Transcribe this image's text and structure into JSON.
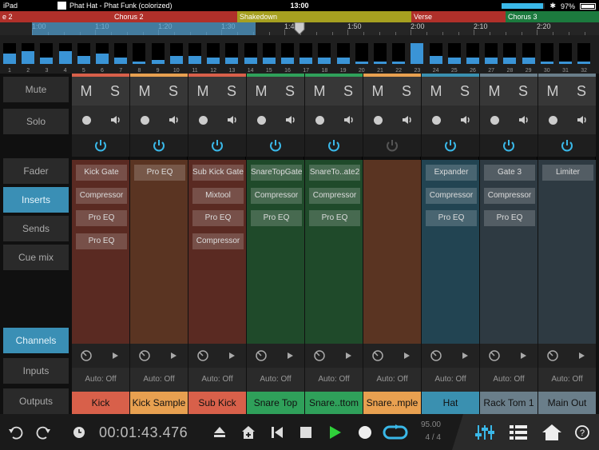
{
  "status": {
    "device": "iPad",
    "document": "Phat Hat - Phat Funk (colorized)",
    "time": "13:00",
    "battery": "97%",
    "level": 0.95,
    "battery_level": 0.97
  },
  "arranger": {
    "sections": [
      {
        "label": "e 2",
        "color": "#b0302a"
      },
      {
        "label": "Chorus 2",
        "color": "#b0302a"
      },
      {
        "label": "Shakedown",
        "color": "#a6a020"
      },
      {
        "label": "Verse",
        "color": "#b0302a"
      },
      {
        "label": "Chorus 3",
        "color": "#1c7a3e"
      }
    ],
    "ticks": [
      "1:00",
      "1:10",
      "1:20",
      "1:30",
      "1:40",
      "1:50",
      "2:00",
      "2:10",
      "2:20"
    ]
  },
  "overview": {
    "numbers": [
      "1",
      "2",
      "3",
      "4",
      "5",
      "6",
      "7",
      "8",
      "9",
      "10",
      "11",
      "12",
      "13",
      "14",
      "15",
      "16",
      "17",
      "18",
      "19",
      "20",
      "21",
      "22",
      "23",
      "24",
      "25",
      "26",
      "27",
      "28",
      "29",
      "30",
      "31",
      "32"
    ],
    "levels": [
      0.5,
      0.6,
      0.3,
      0.6,
      0.4,
      0.5,
      0.3,
      0.1,
      0.2,
      0.4,
      0.4,
      0.3,
      0.3,
      0.3,
      0.3,
      0.3,
      0.3,
      0.3,
      0.3,
      0.1,
      0.1,
      0.1,
      1.0,
      0.4,
      0.3,
      0.3,
      0.3,
      0.3,
      0.3,
      0.1,
      0.1,
      0.1
    ]
  },
  "left_panel": {
    "mute": "Mute",
    "solo": "Solo",
    "fader": "Fader",
    "inserts": "Inserts",
    "sends": "Sends",
    "cue_mix": "Cue mix",
    "channels": "Channels",
    "inputs": "Inputs",
    "outputs": "Outputs"
  },
  "channels": [
    {
      "name": "Kick",
      "color": "#d8604a",
      "bg": "#5a2a22",
      "m": "M",
      "s": "S",
      "auto": "Auto: Off",
      "inserts": [
        "Kick Gate",
        "Compressor",
        "Pro EQ",
        "Pro EQ"
      ],
      "power": "on"
    },
    {
      "name": "Kick Sample",
      "color": "#e8a050",
      "bg": "#5a3422",
      "m": "M",
      "s": "S",
      "auto": "Auto: Off",
      "inserts": [
        "Pro EQ"
      ],
      "power": "on"
    },
    {
      "name": "Sub Kick",
      "color": "#d8604a",
      "bg": "#5a2a22",
      "m": "M",
      "s": "S",
      "auto": "Auto: Off",
      "inserts": [
        "Sub Kick Gate",
        "Mixtool",
        "Pro EQ",
        "Compressor"
      ],
      "power": "on"
    },
    {
      "name": "Snare Top",
      "color": "#2fa05a",
      "bg": "#1f4a2a",
      "m": "M",
      "s": "S",
      "auto": "Auto: Off",
      "inserts": [
        "SnareTopGate",
        "Compressor",
        "Pro EQ"
      ],
      "power": "on"
    },
    {
      "name": "Snare..ttom",
      "color": "#2fa05a",
      "bg": "#1f4a2a",
      "m": "M",
      "s": "S",
      "auto": "Auto: Off",
      "inserts": [
        "SnareTo..ate2",
        "Compressor",
        "Pro EQ"
      ],
      "power": "on"
    },
    {
      "name": "Snare..mple",
      "color": "#e8a050",
      "bg": "#5a3422",
      "m": "M",
      "s": "S",
      "auto": "Auto: Off",
      "inserts": [],
      "power": "off"
    },
    {
      "name": "Hat",
      "color": "#3a90b0",
      "bg": "#224452",
      "m": "M",
      "s": "S",
      "auto": "Auto: Off",
      "inserts": [
        "Expander",
        "Compressor",
        "Pro EQ"
      ],
      "power": "on"
    },
    {
      "name": "Rack Tom 1",
      "color": "#6a7e8a",
      "bg": "#2e3a42",
      "m": "M",
      "s": "S",
      "auto": "Auto: Off",
      "inserts": [
        "Gate 3",
        "Compressor",
        "Pro EQ"
      ],
      "power": "on"
    },
    {
      "name": "Main Out",
      "color": "#6a7e8a",
      "bg": "#2e3a42",
      "m": "M",
      "s": "S",
      "auto": "Auto: Off",
      "inserts": [
        "Limiter"
      ],
      "power": "on"
    }
  ],
  "transport": {
    "clock": "00:01:43.476",
    "tempo": "95.00",
    "signature": "4 / 4"
  },
  "colors": {
    "accent": "#3ab8e8",
    "play": "#2fd03a"
  },
  "icons": [
    "undo-icon",
    "redo-icon",
    "clock-icon",
    "eject-icon",
    "home-add-icon",
    "rewind-icon",
    "stop-icon",
    "play-icon",
    "record-icon",
    "loop-icon",
    "mixer-icon",
    "list-icon",
    "home-icon",
    "help-icon",
    "power-icon",
    "knob-icon",
    "send-icon"
  ]
}
